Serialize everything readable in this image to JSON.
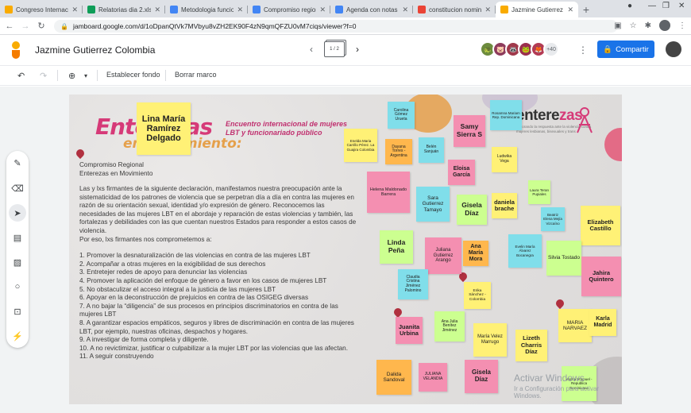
{
  "browser": {
    "tabs": [
      {
        "title": "Congreso Internaciona...",
        "color": "#f9ab00",
        "active": false
      },
      {
        "title": "Relatorias dia 2.xlsx",
        "color": "#0f9d58",
        "active": false
      },
      {
        "title": "Metodologia funcion...",
        "color": "#4285f4",
        "active": false
      },
      {
        "title": "Compromiso regional...",
        "color": "#4285f4",
        "active": false
      },
      {
        "title": "Agenda con notas d...",
        "color": "#4285f4",
        "active": false
      },
      {
        "title": "constitucion nomina...",
        "color": "#ea4335",
        "active": false
      },
      {
        "title": "Jazmine Gutierrez C...",
        "color": "#f9ab00",
        "active": true
      }
    ],
    "url": "jamboard.google.com/d/1oDpanQtVk7MVbyu8vZH2EK90F4zN9qmQFZU0vM7ciqs/viewer?f=0"
  },
  "app": {
    "title": "Jazmine Gutierrez Colombia",
    "frame_indicator": "1 / 2",
    "collaborator_count": "+40",
    "share_label": "Compartir"
  },
  "toolbar": {
    "set_background": "Establecer fondo",
    "clear_frame": "Borrar marco"
  },
  "frame": {
    "headline_1": "Enterezas",
    "headline_2": "en movimiento:",
    "subtitle": "Encuentro internacional de mujeres LBT y funcionariado público",
    "org_1": "Compromiso Regional",
    "org_2": "Enterezas en Movimiento",
    "intro": "Las y lxs firmantes de la siguiente declaración, manifestamos nuestra preocupación ante la sistematicidad de los patrones de violencia que se perpetran día a día en contra las mujeres en razón de su orientación sexual, identidad y/o expresión de género. Reconocemos las necesidades de las mujeres LBT en el abordaje y reparación de estas violencias y también, las fortalezas y debilidades con las que cuentan nuestros Estados para responder a estos casos de violencia.",
    "commit_lead": "Por eso, lxs firmantes nos comprometemos a:",
    "commitments": [
      "1. Promover la desnaturalización de las violencias en contra de las mujeres LBT",
      "2. Acompañar a otras mujeres en la exigibilidad de sus derechos",
      "3. Entretejer redes de apoyo para denunciar las violencias",
      "4. Promover la aplicación del enfoque de género a favor en los casos de mujeres LBT",
      "5. No obstaculizar el acceso integral a la justicia de las mujeres LBT",
      "6. Apoyar en la deconstrucción de prejuicios en contra de las OSIGEG diversas",
      "7. A no bajar la “diligencia” de sus procesos en principios discriminatorios en contra de las mujeres LBT",
      "8. A garantizar espacios empáticos, seguros y libres de discriminación en contra de las mujeres LBT, por ejemplo, nuestras oficinas, despachos y hogares.",
      "9. A investigar de forma completa y diligente.",
      "10. A no revictimizar, justificar o culpabilizar a la mujer LBT por las violencias que las afectan.",
      "11. A seguir construyendo"
    ],
    "logo_word": "entere",
    "logo_word_accent": "zas",
    "logo_tag": "Mejorando la respuesta ante la violencia contra mujeres lesbianas, bisexuales y trans",
    "watermark_1": "Activar Windows",
    "watermark_2": "Ir a Configuración para activar Windows."
  },
  "notes": [
    {
      "text": "Lina María Ramírez Delgado",
      "color": "#fff176",
      "size": 11
    },
    {
      "text": "Carolina Gómez Urueta",
      "color": "#80deea",
      "size": 5
    },
    {
      "text": "Rosamna Mariam Rep. Dominicana",
      "color": "#80deea",
      "size": 4.5
    },
    {
      "text": "Samy Sierra S",
      "color": "#f48fb1",
      "size": 8.5
    },
    {
      "text": "Enelda Maria Carrillo Pérez. La Guajira Colombia",
      "color": "#fff176",
      "size": 4.5
    },
    {
      "text": "Dayana Torres - Argentina",
      "color": "#ffb74d",
      "size": 5
    },
    {
      "text": "Belén Sanjuán",
      "color": "#80deea",
      "size": 5
    },
    {
      "text": "Ludwika Vega",
      "color": "#fff176",
      "size": 5
    },
    {
      "text": "Eloisa García",
      "color": "#f48fb1",
      "size": 7
    },
    {
      "text": "Helena Maldonado Barrera",
      "color": "#f48fb1",
      "size": 5.5
    },
    {
      "text": "Sara Gutierrez Tamayo",
      "color": "#80deea",
      "size": 6.5
    },
    {
      "text": "Gisela Díaz",
      "color": "#ccff90",
      "size": 8.5
    },
    {
      "text": "daniela brache",
      "color": "#fff176",
      "size": 7.5
    },
    {
      "text": "Laura Teran Pupiales",
      "color": "#ccff90",
      "size": 4.5
    },
    {
      "text": "Beatriz Elena Mejía Vizcaíno",
      "color": "#80deea",
      "size": 4.5
    },
    {
      "text": "Elizabeth Castillo",
      "color": "#fff176",
      "size": 7.5
    },
    {
      "text": "Linda Peña",
      "color": "#ccff90",
      "size": 8.5
    },
    {
      "text": "Juliana Gutierrez Arango",
      "color": "#f48fb1",
      "size": 6
    },
    {
      "text": "Ana María Mora",
      "color": "#ffb74d",
      "size": 7
    },
    {
      "text": "Evelin María Álvarez Bocanegra",
      "color": "#80deea",
      "size": 4.5
    },
    {
      "text": "Silvia Tostado",
      "color": "#ccff90",
      "size": 6.5
    },
    {
      "text": "Jahira Quintero",
      "color": "#f48fb1",
      "size": 7.5
    },
    {
      "text": "Claudia Cristina Jiménez Palomino",
      "color": "#80deea",
      "size": 5
    },
    {
      "text": "Erika Sánchez - Colombia",
      "color": "#fff176",
      "size": 4.8
    },
    {
      "text": "Ana Julia Benítez Jiménez",
      "color": "#ccff90",
      "size": 5
    },
    {
      "text": "Juanita Urbina",
      "color": "#f48fb1",
      "size": 7.5
    },
    {
      "text": "María Velez Marrugo",
      "color": "#fff176",
      "size": 6
    },
    {
      "text": "Lizeth Charris Díaz",
      "color": "#fff176",
      "size": 7.5
    },
    {
      "text": "MARIA NARVAEZ",
      "color": "#fff176",
      "size": 6.5
    },
    {
      "text": "Karla Madrid",
      "color": "#fff176",
      "size": 7
    },
    {
      "text": "Dalida Sandoval",
      "color": "#ffb74d",
      "size": 6.5
    },
    {
      "text": "JULIANA VELANDIA",
      "color": "#f48fb1",
      "size": 5
    },
    {
      "text": "Gisela Díaz",
      "color": "#f48fb1",
      "size": 8
    },
    {
      "text": "Yanna Vonpuel - Republica Dominicana",
      "color": "#ccff90",
      "size": 4.5
    }
  ]
}
